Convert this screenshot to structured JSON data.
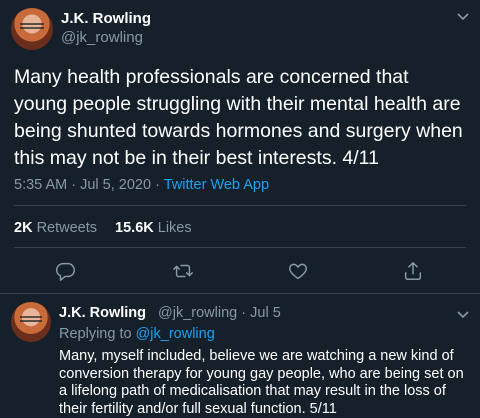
{
  "tweet": {
    "author_name": "J.K. Rowling",
    "author_handle": "@jk_rowling",
    "text": "Many health professionals are concerned that young people struggling with their mental health are being shunted towards hormones and surgery when this may not be in their best interests. 4/11",
    "time": "5:35 AM",
    "separator": "·",
    "date": "Jul 5, 2020",
    "app": "Twitter Web App",
    "retweets_count": "2K",
    "retweets_label": "Retweets",
    "likes_count": "15.6K",
    "likes_label": "Likes"
  },
  "actions": {
    "reply_icon": "reply-icon",
    "retweet_icon": "retweet-icon",
    "like_icon": "heart-icon",
    "share_icon": "share-icon"
  },
  "reply": {
    "author_name": "J.K. Rowling",
    "author_handle": "@jk_rowling",
    "separator": "·",
    "date": "Jul 5",
    "replying_prefix": "Replying to",
    "replying_to": "@jk_rowling",
    "text": "Many, myself included, believe we are watching a new kind of conversion therapy for young gay people, who are being set on a lifelong path of medicalisation that may result in the loss of their fertility and/or full sexual function. 5/11"
  },
  "colors": {
    "background": "#15202b",
    "text": "#ffffff",
    "secondary": "#8899a6",
    "accent": "#1da1f2",
    "divider": "#38444d"
  }
}
